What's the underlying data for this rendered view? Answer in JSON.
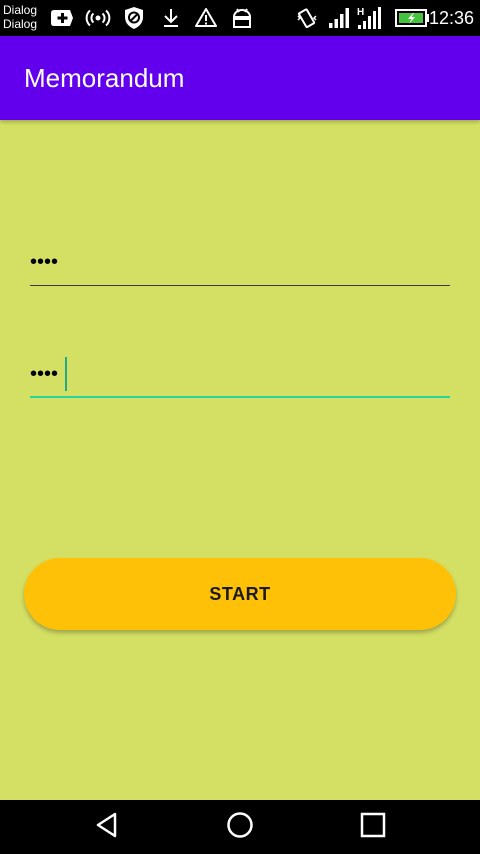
{
  "status_bar": {
    "notification_line1": "Dialog",
    "notification_line2": "Dialog",
    "time": "12:36",
    "network_label": "H",
    "icons": [
      "add-box-icon",
      "broadcast-icon",
      "blocked-icon",
      "download-icon",
      "warning-icon",
      "android-icon",
      "vibrate-icon",
      "signal-icon",
      "signal-h-icon",
      "battery-charging-icon"
    ]
  },
  "app_bar": {
    "title": "Memorandum",
    "color": "#6200ee"
  },
  "form": {
    "password1_value": "••••",
    "password2_value": "••••",
    "start_label": "START",
    "background": "#d4e064",
    "button_color": "#ffc107",
    "focus_color": "#2ad4a0"
  },
  "nav_bar": {
    "icons": [
      "back-icon",
      "home-icon",
      "recent-apps-icon"
    ]
  }
}
